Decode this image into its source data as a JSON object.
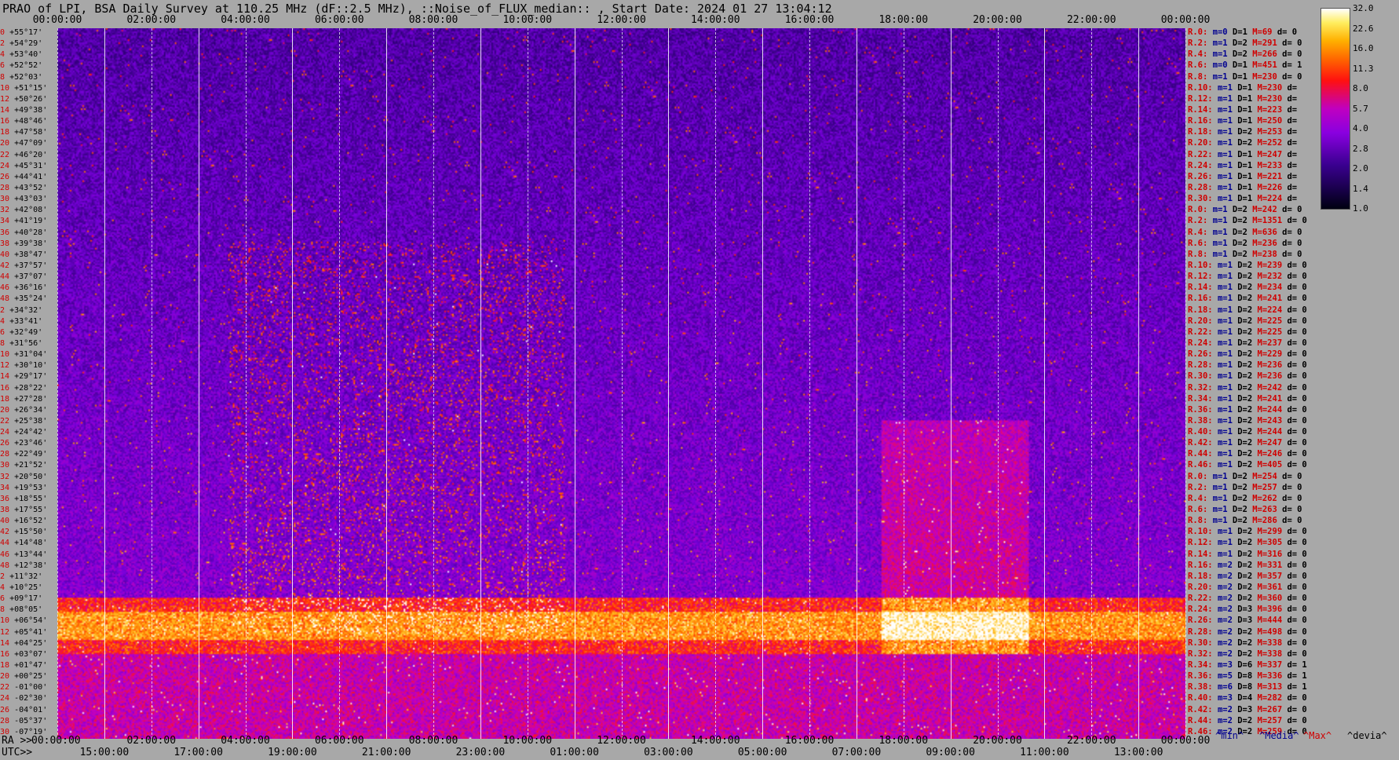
{
  "title": "PRAO of LPI, BSA Daily Survey at 110.25 MHz (dF::2.5 MHz), ::Noise_of_FLUX_median:: , Start Date: 2024 01 27 13:04:12",
  "chart_data": {
    "type": "heatmap",
    "top_axis_utc": [
      "00:00:00",
      "02:00:00",
      "04:00:00",
      "06:00:00",
      "08:00:00",
      "10:00:00",
      "12:00:00",
      "14:00:00",
      "16:00:00",
      "18:00:00",
      "20:00:00",
      "22:00:00",
      "00:00:00"
    ],
    "bottom_axis_ra": [
      "00:00:00",
      "02:00:00",
      "04:00:00",
      "06:00:00",
      "08:00:00",
      "10:00:00",
      "12:00:00",
      "14:00:00",
      "16:00:00",
      "18:00:00",
      "20:00:00",
      "22:00:00",
      "00:00:00"
    ],
    "bottom_axis_utc": [
      "15:00:00",
      "17:00:00",
      "19:00:00",
      "21:00:00",
      "23:00:00",
      "01:00:00",
      "03:00:00",
      "05:00:00",
      "07:00:00",
      "09:00:00",
      "11:00:00",
      "13:00:00"
    ],
    "ra_prefix": "RA >>",
    "utc_prefix": "UTC>>",
    "colorbar_ticks": [
      "32.0",
      "22.6",
      "16.0",
      "11.3",
      "8.0",
      "5.7",
      "4.0",
      "2.8",
      "2.0",
      "1.4",
      "1.0"
    ],
    "declinations": [
      "+55°17'",
      "+54°29'",
      "+53°40'",
      "+52°52'",
      "+52°03'",
      "+51°15'",
      "+50°26'",
      "+49°38'",
      "+48°46'",
      "+47°58'",
      "+47°09'",
      "+46°20'",
      "+45°31'",
      "+44°41'",
      "+43°52'",
      "+43°03'",
      "+42°08'",
      "+41°19'",
      "+40°28'",
      "+39°38'",
      "+38°47'",
      "+37°57'",
      "+37°07'",
      "+36°16'",
      "+35°24'",
      "+34°32'",
      "+33°41'",
      "+32°49'",
      "+31°56'",
      "+31°04'",
      "+30°10'",
      "+29°17'",
      "+28°22'",
      "+27°28'",
      "+26°34'",
      "+25°38'",
      "+24°42'",
      "+23°46'",
      "+22°49'",
      "+21°52'",
      "+20°50'",
      "+19°53'",
      "+18°55'",
      "+17°55'",
      "+16°52'",
      "+15°50'",
      "+14°48'",
      "+13°44'",
      "+12°38'",
      "+11°32'",
      "+10°25'",
      "+09°17'",
      "+08°05'",
      "+06°54'",
      "+05°41'",
      "+04°25'",
      "+03°07'",
      "+01°47'",
      "+00°25'",
      "-01°00'",
      "-02°30'",
      "-04°01'",
      "-05°37'",
      "-07°19'"
    ],
    "row_numbers": [
      "0",
      "2",
      "4",
      "6",
      "8",
      "10",
      "12",
      "14",
      "16",
      "18",
      "20",
      "22",
      "24",
      "26",
      "28",
      "30",
      "32",
      "34",
      "36",
      "38",
      "40",
      "42",
      "44",
      "46",
      "48",
      "2",
      "4",
      "6",
      "8",
      "10",
      "12",
      "14",
      "16",
      "18",
      "20",
      "22",
      "24",
      "26",
      "28",
      "30",
      "32",
      "34",
      "36",
      "38",
      "40",
      "42",
      "44",
      "46",
      "48",
      "2",
      "4",
      "6",
      "8",
      "10",
      "12",
      "14",
      "16",
      "18",
      "20",
      "22",
      "24",
      "26",
      "28",
      "30"
    ],
    "right_stats": [
      {
        "r": "R.0:",
        "m": "m=0",
        "d": "D=1",
        "x": "M=69",
        "v": "d= 0"
      },
      {
        "r": "R.2:",
        "m": "m=1",
        "d": "D=2",
        "x": "M=291",
        "v": "d= 0"
      },
      {
        "r": "R.4:",
        "m": "m=1",
        "d": "D=2",
        "x": "M=266",
        "v": "d= 0"
      },
      {
        "r": "R.6:",
        "m": "m=0",
        "d": "D=1",
        "x": "M=451",
        "v": "d= 1"
      },
      {
        "r": "R.8:",
        "m": "m=1",
        "d": "D=1",
        "x": "M=230",
        "v": "d= 0"
      },
      {
        "r": "R.10:",
        "m": "m=1",
        "d": "D=1",
        "x": "M=230",
        "v": "d="
      },
      {
        "r": "R.12:",
        "m": "m=1",
        "d": "D=1",
        "x": "M=230",
        "v": "d="
      },
      {
        "r": "R.14:",
        "m": "m=1",
        "d": "D=1",
        "x": "M=223",
        "v": "d="
      },
      {
        "r": "R.16:",
        "m": "m=1",
        "d": "D=1",
        "x": "M=250",
        "v": "d="
      },
      {
        "r": "R.18:",
        "m": "m=1",
        "d": "D=2",
        "x": "M=253",
        "v": "d="
      },
      {
        "r": "R.20:",
        "m": "m=1",
        "d": "D=2",
        "x": "M=252",
        "v": "d="
      },
      {
        "r": "R.22:",
        "m": "m=1",
        "d": "D=1",
        "x": "M=247",
        "v": "d="
      },
      {
        "r": "R.24:",
        "m": "m=1",
        "d": "D=1",
        "x": "M=233",
        "v": "d="
      },
      {
        "r": "R.26:",
        "m": "m=1",
        "d": "D=1",
        "x": "M=221",
        "v": "d="
      },
      {
        "r": "R.28:",
        "m": "m=1",
        "d": "D=1",
        "x": "M=226",
        "v": "d="
      },
      {
        "r": "R.30:",
        "m": "m=1",
        "d": "D=1",
        "x": "M=224",
        "v": "d="
      },
      {
        "r": "R.0:",
        "m": "m=1",
        "d": "D=2",
        "x": "M=242",
        "v": "d= 0"
      },
      {
        "r": "R.2:",
        "m": "m=1",
        "d": "D=2",
        "x": "M=1351",
        "v": "d= 0"
      },
      {
        "r": "R.4:",
        "m": "m=1",
        "d": "D=2",
        "x": "M=636",
        "v": "d= 0"
      },
      {
        "r": "R.6:",
        "m": "m=1",
        "d": "D=2",
        "x": "M=236",
        "v": "d= 0"
      },
      {
        "r": "R.8:",
        "m": "m=1",
        "d": "D=2",
        "x": "M=238",
        "v": "d= 0"
      },
      {
        "r": "R.10:",
        "m": "m=1",
        "d": "D=2",
        "x": "M=239",
        "v": "d= 0"
      },
      {
        "r": "R.12:",
        "m": "m=1",
        "d": "D=2",
        "x": "M=232",
        "v": "d= 0"
      },
      {
        "r": "R.14:",
        "m": "m=1",
        "d": "D=2",
        "x": "M=234",
        "v": "d= 0"
      },
      {
        "r": "R.16:",
        "m": "m=1",
        "d": "D=2",
        "x": "M=241",
        "v": "d= 0"
      },
      {
        "r": "R.18:",
        "m": "m=1",
        "d": "D=2",
        "x": "M=224",
        "v": "d= 0"
      },
      {
        "r": "R.20:",
        "m": "m=1",
        "d": "D=2",
        "x": "M=225",
        "v": "d= 0"
      },
      {
        "r": "R.22:",
        "m": "m=1",
        "d": "D=2",
        "x": "M=225",
        "v": "d= 0"
      },
      {
        "r": "R.24:",
        "m": "m=1",
        "d": "D=2",
        "x": "M=237",
        "v": "d= 0"
      },
      {
        "r": "R.26:",
        "m": "m=1",
        "d": "D=2",
        "x": "M=229",
        "v": "d= 0"
      },
      {
        "r": "R.28:",
        "m": "m=1",
        "d": "D=2",
        "x": "M=236",
        "v": "d= 0"
      },
      {
        "r": "R.30:",
        "m": "m=1",
        "d": "D=2",
        "x": "M=236",
        "v": "d= 0"
      },
      {
        "r": "R.32:",
        "m": "m=1",
        "d": "D=2",
        "x": "M=242",
        "v": "d= 0"
      },
      {
        "r": "R.34:",
        "m": "m=1",
        "d": "D=2",
        "x": "M=241",
        "v": "d= 0"
      },
      {
        "r": "R.36:",
        "m": "m=1",
        "d": "D=2",
        "x": "M=244",
        "v": "d= 0"
      },
      {
        "r": "R.38:",
        "m": "m=1",
        "d": "D=2",
        "x": "M=243",
        "v": "d= 0"
      },
      {
        "r": "R.40:",
        "m": "m=1",
        "d": "D=2",
        "x": "M=244",
        "v": "d= 0"
      },
      {
        "r": "R.42:",
        "m": "m=1",
        "d": "D=2",
        "x": "M=247",
        "v": "d= 0"
      },
      {
        "r": "R.44:",
        "m": "m=1",
        "d": "D=2",
        "x": "M=246",
        "v": "d= 0"
      },
      {
        "r": "R.46:",
        "m": "m=1",
        "d": "D=2",
        "x": "M=405",
        "v": "d= 0"
      },
      {
        "r": "R.0:",
        "m": "m=1",
        "d": "D=2",
        "x": "M=254",
        "v": "d= 0"
      },
      {
        "r": "R.2:",
        "m": "m=1",
        "d": "D=2",
        "x": "M=257",
        "v": "d= 0"
      },
      {
        "r": "R.4:",
        "m": "m=1",
        "d": "D=2",
        "x": "M=262",
        "v": "d= 0"
      },
      {
        "r": "R.6:",
        "m": "m=1",
        "d": "D=2",
        "x": "M=263",
        "v": "d= 0"
      },
      {
        "r": "R.8:",
        "m": "m=1",
        "d": "D=2",
        "x": "M=286",
        "v": "d= 0"
      },
      {
        "r": "R.10:",
        "m": "m=1",
        "d": "D=2",
        "x": "M=299",
        "v": "d= 0"
      },
      {
        "r": "R.12:",
        "m": "m=1",
        "d": "D=2",
        "x": "M=305",
        "v": "d= 0"
      },
      {
        "r": "R.14:",
        "m": "m=1",
        "d": "D=2",
        "x": "M=316",
        "v": "d= 0"
      },
      {
        "r": "R.16:",
        "m": "m=2",
        "d": "D=2",
        "x": "M=331",
        "v": "d= 0"
      },
      {
        "r": "R.18:",
        "m": "m=2",
        "d": "D=2",
        "x": "M=357",
        "v": "d= 0"
      },
      {
        "r": "R.20:",
        "m": "m=2",
        "d": "D=2",
        "x": "M=361",
        "v": "d= 0"
      },
      {
        "r": "R.22:",
        "m": "m=2",
        "d": "D=2",
        "x": "M=360",
        "v": "d= 0"
      },
      {
        "r": "R.24:",
        "m": "m=2",
        "d": "D=3",
        "x": "M=396",
        "v": "d= 0"
      },
      {
        "r": "R.26:",
        "m": "m=2",
        "d": "D=3",
        "x": "M=444",
        "v": "d= 0"
      },
      {
        "r": "R.28:",
        "m": "m=2",
        "d": "D=2",
        "x": "M=498",
        "v": "d= 0"
      },
      {
        "r": "R.30:",
        "m": "m=2",
        "d": "D=2",
        "x": "M=338",
        "v": "d= 0"
      },
      {
        "r": "R.32:",
        "m": "m=2",
        "d": "D=2",
        "x": "M=338",
        "v": "d= 0"
      },
      {
        "r": "R.34:",
        "m": "m=3",
        "d": "D=6",
        "x": "M=337",
        "v": "d= 1"
      },
      {
        "r": "R.36:",
        "m": "m=5",
        "d": "D=8",
        "x": "M=336",
        "v": "d= 1"
      },
      {
        "r": "R.38:",
        "m": "m=6",
        "d": "D=8",
        "x": "M=313",
        "v": "d= 1"
      },
      {
        "r": "R.40:",
        "m": "m=3",
        "d": "D=4",
        "x": "M=282",
        "v": "d= 0"
      },
      {
        "r": "R.42:",
        "m": "m=2",
        "d": "D=3",
        "x": "M=267",
        "v": "d= 0"
      },
      {
        "r": "R.44:",
        "m": "m=2",
        "d": "D=2",
        "x": "M=257",
        "v": "d= 0"
      },
      {
        "r": "R.46:",
        "m": "m=2",
        "d": "D=2",
        "x": "M=259",
        "v": "d= 0"
      }
    ],
    "footer_legend": [
      "^min^",
      "^Media^",
      "^Max^",
      "^devia^"
    ],
    "colors": {
      "background": "#a8a8a8",
      "band_red": "#ff2020",
      "band_yellow": "#ffd000",
      "base": "#1a0540"
    }
  }
}
